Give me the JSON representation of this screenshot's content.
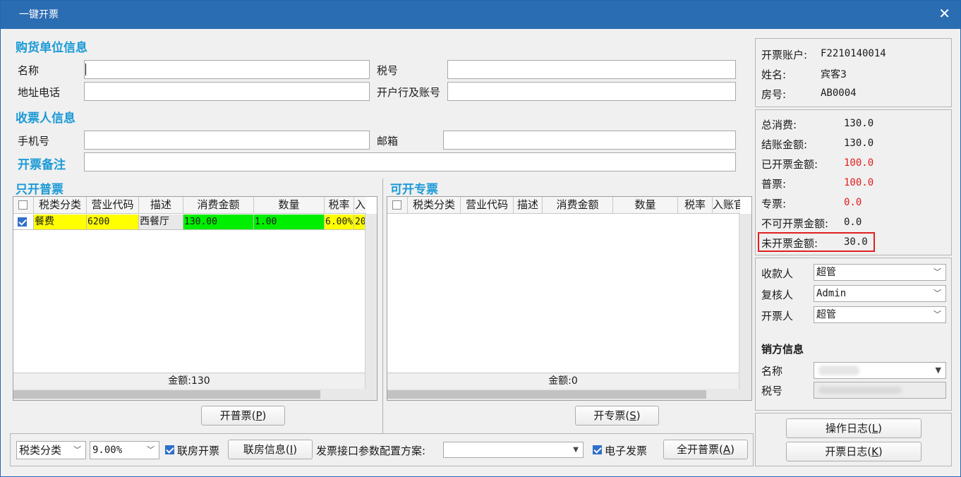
{
  "window": {
    "title": "一键开票",
    "close_glyph": "✕"
  },
  "buyer": {
    "section_title": "购货单位信息",
    "name_label": "名称",
    "name_value": "",
    "taxno_label": "税号",
    "taxno_value": "",
    "addr_label": "地址电话",
    "addr_value": "",
    "bank_label": "开户行及账号",
    "bank_value": ""
  },
  "receiver": {
    "section_title": "收票人信息",
    "phone_label": "手机号",
    "phone_value": "",
    "email_label": "邮箱",
    "email_value": "",
    "remark_label": "开票备注",
    "remark_value": ""
  },
  "normal": {
    "title": "只开普票",
    "columns": [
      "税类分类",
      "营业代码",
      "描述",
      "消费金额",
      "数量",
      "税率",
      "入"
    ],
    "rows": [
      {
        "checked": true,
        "category": "餐费",
        "code": "6200",
        "desc": "西餐厅",
        "amount": "130.00",
        "qty": "1.00",
        "rate": "6.00%",
        "extra": "20"
      }
    ],
    "total": "金额:130",
    "button": {
      "text": "开普票(",
      "key": "P",
      "suffix": ")"
    }
  },
  "special": {
    "title": "可开专票",
    "columns": [
      "税类分类",
      "营业代码",
      "描述",
      "消费金额",
      "数量",
      "税率",
      "入账官"
    ],
    "total": "金额:0",
    "button": {
      "text": "开专票(",
      "key": "S",
      "suffix": ")"
    }
  },
  "bottom": {
    "tax_category": "税类分类",
    "tax_rate": "9.00%",
    "lianfang_label": "联房开票",
    "lianfang_checked": true,
    "lianfang_info_button": {
      "text": "联房信息(",
      "key": "I",
      "suffix": ")"
    },
    "config_label": "发票接口参数配置方案:",
    "config_value": "",
    "einvoice_label": "电子发票",
    "einvoice_checked": true,
    "all_button": {
      "text": "全开普票(",
      "key": "A",
      "suffix": ")"
    }
  },
  "account": {
    "account_label": "开票账户:",
    "account_value": "F2210140014",
    "name_label": "姓名:",
    "name_value": "宾客3",
    "room_label": "房号:",
    "room_value": "AB0004"
  },
  "amounts": {
    "total_label": "总消费:",
    "total_value": "130.0",
    "checkout_label": "结账金额:",
    "checkout_value": "130.0",
    "invoiced_label": "已开票金额:",
    "invoiced_value": "100.0",
    "normal_label": "普票:",
    "normal_value": "100.0",
    "special_label": "专票:",
    "special_value": "0.0",
    "noninvoice_label": "不可开票金额:",
    "noninvoice_value": "0.0",
    "uninvoiced_label": "未开票金额:",
    "uninvoiced_value": "30.0",
    "highlight_color": "#e02020"
  },
  "staff": {
    "payee_label": "收款人",
    "payee_value": "超管",
    "reviewer_label": "复核人",
    "reviewer_value": "Admin",
    "drawer_label": "开票人",
    "drawer_value": "超管"
  },
  "seller": {
    "section_title": "销方信息",
    "name_label": "名称",
    "taxno_label": "税号"
  },
  "logs": {
    "op_log": {
      "text": "操作日志(",
      "key": "L",
      "suffix": ")"
    },
    "invoice_log": {
      "text": "开票日志(",
      "key": "K",
      "suffix": ")"
    }
  },
  "colors": {
    "title_bar": "#2b6db3",
    "section": "#1a9ad6",
    "row_yellow": "#ffff00",
    "row_green": "#00ee00",
    "red": "#e01b1b"
  }
}
